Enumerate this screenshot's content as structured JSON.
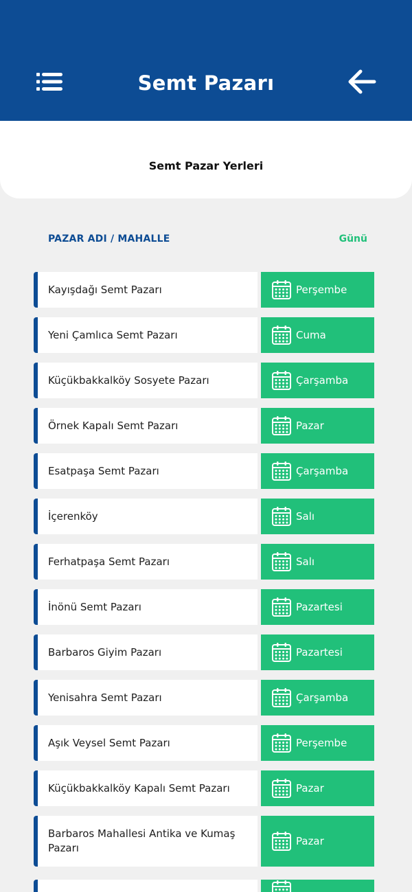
{
  "header": {
    "title": "Semt Pazarı"
  },
  "subheader": {
    "title": "Semt Pazar Yerleri"
  },
  "columns": {
    "left": "PAZAR ADI / MAHALLE",
    "right": "Günü"
  },
  "colors": {
    "primary": "#0d4c94",
    "accent": "#21c07a",
    "background": "#f0f0f0"
  },
  "icons": {
    "menu": "list-menu-icon",
    "back": "arrow-left-icon",
    "day": "calendar-icon"
  },
  "markets": [
    {
      "name": "Kayışdağı Semt Pazarı",
      "day": "Perşembe"
    },
    {
      "name": "Yeni Çamlıca Semt Pazarı",
      "day": "Cuma"
    },
    {
      "name": "Küçükbakkalköy Sosyete Pazarı",
      "day": "Çarşamba"
    },
    {
      "name": "Örnek Kapalı Semt Pazarı",
      "day": "Pazar"
    },
    {
      "name": "Esatpaşa Semt Pazarı",
      "day": "Çarşamba"
    },
    {
      "name": "İçerenköy",
      "day": "Salı"
    },
    {
      "name": "Ferhatpaşa Semt Pazarı",
      "day": "Salı"
    },
    {
      "name": "İnönü Semt Pazarı",
      "day": "Pazartesi"
    },
    {
      "name": "Barbaros Giyim Pazarı",
      "day": "Pazartesi"
    },
    {
      "name": "Yenisahra Semt Pazarı",
      "day": "Çarşamba"
    },
    {
      "name": "Aşık Veysel Semt Pazarı",
      "day": "Perşembe"
    },
    {
      "name": "Küçükbakkalköy Kapalı Semt Pazarı",
      "day": "Pazar"
    },
    {
      "name": "Barbaros Mahallesi Antika ve Kumaş Pazarı",
      "day": "Pazar"
    }
  ]
}
